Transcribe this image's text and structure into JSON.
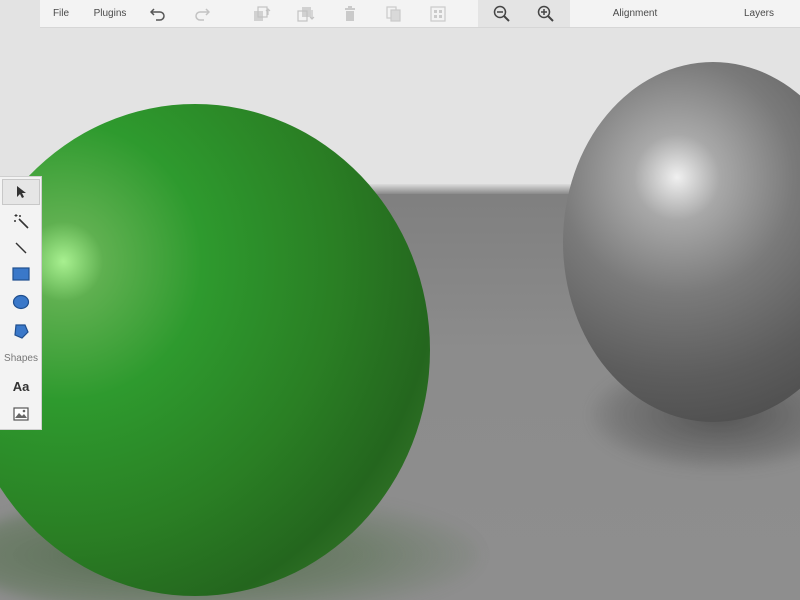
{
  "toolbar": {
    "file_label": "File",
    "plugins_label": "Plugins",
    "alignment_label": "Alignment",
    "layers_label": "Layers",
    "icons": [
      "undo-icon",
      "redo-icon",
      "bring-forward-icon",
      "send-backward-icon",
      "delete-icon",
      "duplicate-icon",
      "group-icon",
      "zoom-out-icon",
      "zoom-in-icon"
    ]
  },
  "palette": {
    "shapes_label": "Shapes",
    "text_tool_label": "Aa",
    "tools": [
      "select-tool",
      "magic-wand-tool",
      "line-tool",
      "rectangle-tool",
      "ellipse-tool",
      "polygon-tool",
      "text-tool",
      "image-tool"
    ]
  },
  "colors": {
    "toolbar_bg": "#f3f3f3",
    "accent_blue": "#3a78c9",
    "green_sphere": "#2e9a2e",
    "gray_sphere": "#6a6a6a",
    "floor": "#8a8a8a",
    "wall": "#e3e3e3"
  }
}
